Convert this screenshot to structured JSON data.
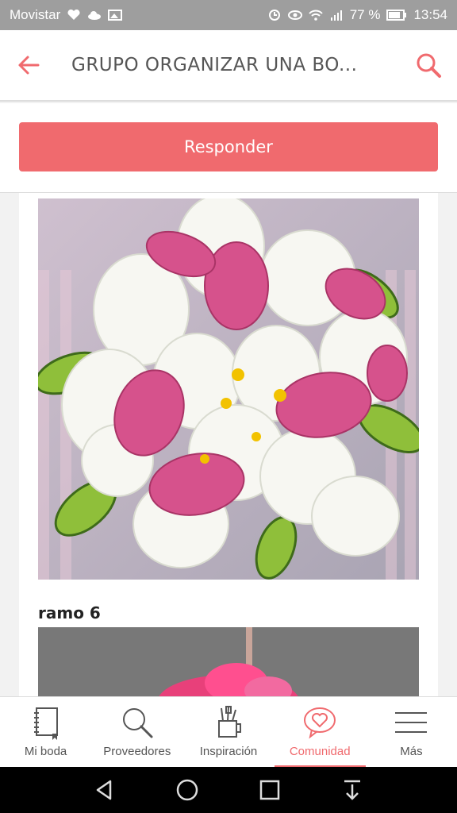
{
  "status_bar": {
    "carrier": "Movistar",
    "battery": "77 %",
    "time": "13:54"
  },
  "app_bar": {
    "title": "GRUPO ORGANIZAR UNA BO..."
  },
  "actions": {
    "reply_label": "Responder"
  },
  "post": {
    "caption": "ramo 6"
  },
  "bottom_nav": {
    "items": [
      {
        "label": "Mi boda",
        "icon": "notebook-icon"
      },
      {
        "label": "Proveedores",
        "icon": "search-icon"
      },
      {
        "label": "Inspiración",
        "icon": "tools-cup-icon"
      },
      {
        "label": "Comunidad",
        "icon": "heart-chat-icon"
      },
      {
        "label": "Más",
        "icon": "menu-icon"
      }
    ],
    "active_index": 3
  },
  "colors": {
    "accent": "#f06a6e",
    "status_bar": "#9e9e9e"
  }
}
